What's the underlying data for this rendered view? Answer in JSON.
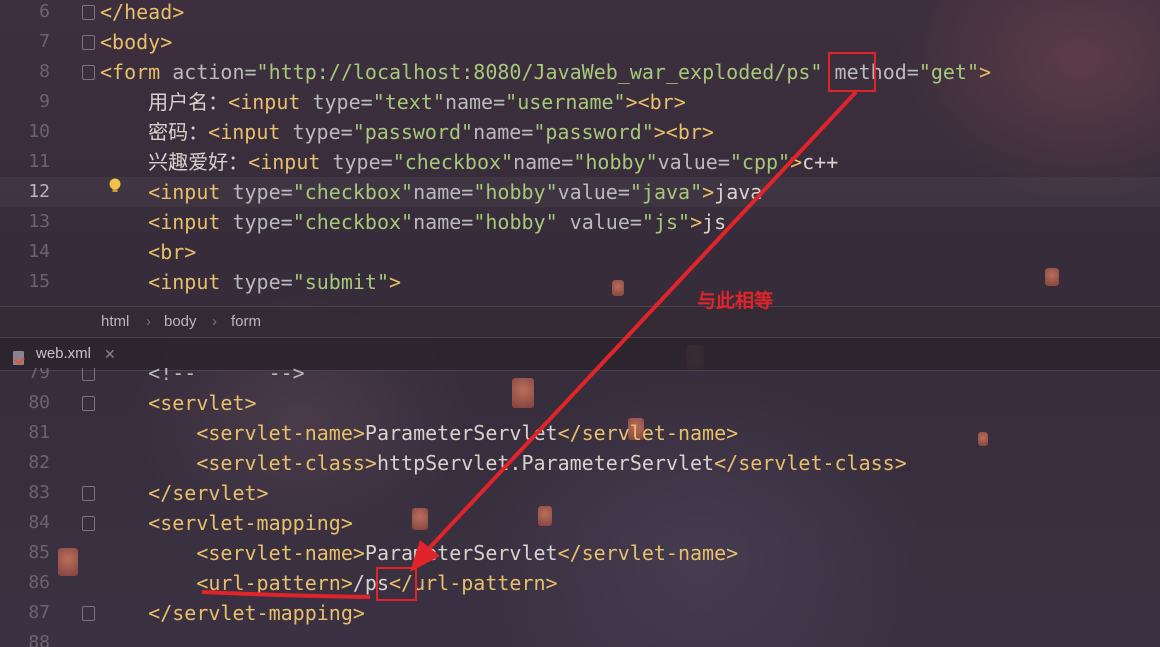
{
  "editor_top": {
    "lines": [
      {
        "num": "6",
        "segs": [
          [
            "t",
            "</head>"
          ]
        ]
      },
      {
        "num": "7",
        "segs": [
          [
            "t",
            "<body>"
          ]
        ]
      },
      {
        "num": "8",
        "segs": [
          [
            "t",
            "<form "
          ],
          [
            "a",
            "action="
          ],
          [
            "s",
            "\"http://localhost:8080/JavaWeb_war_exploded/ps\""
          ],
          [
            "a",
            " method="
          ],
          [
            "s",
            "\"get\""
          ],
          [
            "t",
            ">"
          ]
        ]
      },
      {
        "num": "9",
        "segs": [
          [
            "tx",
            "    用户名："
          ],
          [
            "t",
            "<input "
          ],
          [
            "a",
            "type="
          ],
          [
            "s",
            "\"text\""
          ],
          [
            "a",
            "name="
          ],
          [
            "s",
            "\"username\""
          ],
          [
            "t",
            "><br>"
          ]
        ]
      },
      {
        "num": "10",
        "segs": [
          [
            "tx",
            "    密码："
          ],
          [
            "t",
            "<input "
          ],
          [
            "a",
            "type="
          ],
          [
            "s",
            "\"password\""
          ],
          [
            "a",
            "name="
          ],
          [
            "s",
            "\"password\""
          ],
          [
            "t",
            "><br>"
          ]
        ]
      },
      {
        "num": "11",
        "segs": [
          [
            "tx",
            "    兴趣爱好："
          ],
          [
            "t",
            "<input "
          ],
          [
            "a",
            "type="
          ],
          [
            "s",
            "\"checkbox\""
          ],
          [
            "a",
            "name="
          ],
          [
            "s",
            "\"hobby\""
          ],
          [
            "a",
            "value="
          ],
          [
            "s",
            "\"cpp\""
          ],
          [
            "t",
            ">"
          ],
          [
            "tx",
            "c++"
          ]
        ]
      },
      {
        "num": "12",
        "segs": [
          [
            "tx",
            "    "
          ],
          [
            "t",
            "<input "
          ],
          [
            "a",
            "type="
          ],
          [
            "s",
            "\"checkbox\""
          ],
          [
            "a",
            "name="
          ],
          [
            "s",
            "\"hobby\""
          ],
          [
            "a",
            "value="
          ],
          [
            "s",
            "\"java\""
          ],
          [
            "t",
            ">"
          ],
          [
            "tx",
            "java"
          ]
        ]
      },
      {
        "num": "13",
        "segs": [
          [
            "tx",
            "    "
          ],
          [
            "t",
            "<input "
          ],
          [
            "a",
            "type="
          ],
          [
            "s",
            "\"checkbox\""
          ],
          [
            "a",
            "name="
          ],
          [
            "s",
            "\"hobby\""
          ],
          [
            "a",
            " value="
          ],
          [
            "s",
            "\"js\""
          ],
          [
            "t",
            ">"
          ],
          [
            "tx",
            "js"
          ]
        ]
      },
      {
        "num": "14",
        "segs": [
          [
            "tx",
            "    "
          ],
          [
            "t",
            "<br>"
          ]
        ]
      },
      {
        "num": "15",
        "segs": [
          [
            "tx",
            "    "
          ],
          [
            "t",
            "<input "
          ],
          [
            "a",
            "type="
          ],
          [
            "s",
            "\"submit\""
          ],
          [
            "t",
            ">"
          ]
        ]
      }
    ]
  },
  "breadcrumb": {
    "items": [
      "html",
      "body",
      "form"
    ]
  },
  "file_tab": {
    "label": "web.xml"
  },
  "editor_bottom": {
    "lines": [
      {
        "num": "79",
        "segs": [
          [
            "a",
            "    <!--      -->"
          ]
        ]
      },
      {
        "num": "80",
        "segs": [
          [
            "tx",
            "    "
          ],
          [
            "t",
            "<servlet>"
          ]
        ]
      },
      {
        "num": "81",
        "segs": [
          [
            "tx",
            "        "
          ],
          [
            "t",
            "<servlet-name>"
          ],
          [
            "tx",
            "ParameterServlet"
          ],
          [
            "t",
            "</servlet-name>"
          ]
        ]
      },
      {
        "num": "82",
        "segs": [
          [
            "tx",
            "        "
          ],
          [
            "t",
            "<servlet-class>"
          ],
          [
            "tx",
            "httpServlet.ParameterServlet"
          ],
          [
            "t",
            "</servlet-class>"
          ]
        ]
      },
      {
        "num": "83",
        "segs": [
          [
            "tx",
            "    "
          ],
          [
            "t",
            "</servlet>"
          ]
        ]
      },
      {
        "num": "84",
        "segs": [
          [
            "tx",
            "    "
          ],
          [
            "t",
            "<servlet-mapping>"
          ]
        ]
      },
      {
        "num": "85",
        "segs": [
          [
            "tx",
            "        "
          ],
          [
            "t",
            "<servlet-name>"
          ],
          [
            "tx",
            "ParameterServlet"
          ],
          [
            "t",
            "</servlet-name>"
          ]
        ]
      },
      {
        "num": "86",
        "segs": [
          [
            "tx",
            "        "
          ],
          [
            "t",
            "<url-pattern>"
          ],
          [
            "tx",
            "/ps"
          ],
          [
            "t",
            "</url-pattern>"
          ]
        ]
      },
      {
        "num": "87",
        "segs": [
          [
            "tx",
            "    "
          ],
          [
            "t",
            "</servlet-mapping>"
          ]
        ]
      },
      {
        "num": "88",
        "segs": [
          [
            "tx",
            ""
          ]
        ]
      }
    ]
  },
  "annotation": {
    "text": "与此相等",
    "color": "#e0242a"
  }
}
